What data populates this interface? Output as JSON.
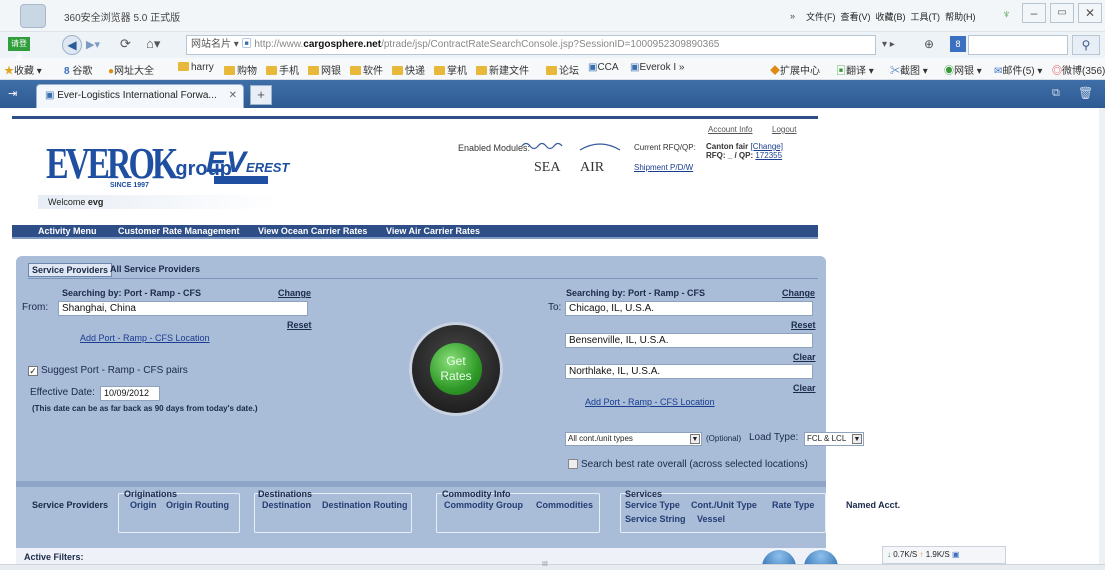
{
  "browser": {
    "title": "360安全浏览器 5.0 正式版",
    "login": "请登录",
    "menu": [
      "文件(F)",
      "查看(V)",
      "收藏(B)",
      "工具(T)",
      "帮助(H)"
    ],
    "url_prefix": "网站名片",
    "url_gray1": "http://www.",
    "url_bold": "cargosphere.net",
    "url_gray2": "/ptrade/jsp/ContractRateSearchConsole.jsp?SessionID=1000952309890365",
    "fav_label": "收藏",
    "favorites": [
      "谷歌",
      "网址大全",
      "harry",
      "购物",
      "手机",
      "网银",
      "软件",
      "快递",
      "掌机",
      "新建文件",
      "论坛",
      "CCA",
      "Everok I"
    ],
    "right_tools": [
      "扩展中心",
      "翻译",
      "截图",
      "网银",
      "邮件(5)",
      "微博(356)"
    ],
    "tab_title": "Ever-Logistics International Forwa...",
    "status": {
      "down": "0.7K/S",
      "up": "1.9K/S"
    },
    "h_scroll_mark": "III"
  },
  "header": {
    "logo_main": "EVEROK",
    "logo_group": "group",
    "logo_since": "SINCE 1997",
    "ev_logo": "EV",
    "ev_rest": "EREST",
    "welcome_label": "Welcome",
    "welcome_user": "evg",
    "account_info": "Account Info",
    "logout": "Logout",
    "enabled_modules": "Enabled Modules:",
    "sea": "SEA",
    "air": "AIR",
    "shipment": "Shipment P/D/W",
    "rfq_label": "Current RFQ/QP:",
    "rfq_value": "Canton fair",
    "change": "[Change]",
    "rfq2": "RFQ: _ / QP:",
    "qp": "172355"
  },
  "nav": [
    "Activity Menu",
    "Customer Rate Management",
    "View Ocean Carrier Rates",
    "View Air Carrier Rates"
  ],
  "search": {
    "tabs": [
      "Service Providers",
      "All Service Providers"
    ],
    "searching_by": "Searching by: Port - Ramp - CFS",
    "change": "Change",
    "from_label": "From:",
    "from_value": "Shanghai, China",
    "reset": "Reset",
    "add_location": "Add Port - Ramp - CFS Location",
    "suggest": "Suggest Port - Ramp - CFS pairs",
    "effective_label": "Effective Date:",
    "effective_value": "10/09/2012",
    "date_note": "(This date can be as far back as 90 days from today's date.)",
    "get_rates": [
      "Get",
      "Rates"
    ],
    "to_label": "To:",
    "to_values": [
      "Chicago, IL, U.S.A.",
      "Bensenville, IL, U.S.A.",
      "Northlake, IL, U.S.A."
    ],
    "clear": "Clear",
    "cont_type": "All cont./unit types",
    "optional": "(Optional)",
    "load_type_label": "Load Type:",
    "load_type_value": "FCL & LCL",
    "best_rate": "Search best rate overall (across selected locations)"
  },
  "filters": {
    "service_providers": "Service Providers",
    "originations": {
      "title": "Originations",
      "items": [
        "Origin",
        "Origin Routing"
      ]
    },
    "destinations": {
      "title": "Destinations",
      "items": [
        "Destination",
        "Destination Routing"
      ]
    },
    "commodity": {
      "title": "Commodity Info",
      "items": [
        "Commodity Group",
        "Commodities"
      ]
    },
    "services": {
      "title": "Services",
      "items": [
        "Service Type",
        "Cont./Unit Type",
        "Rate Type",
        "Service String",
        "Vessel"
      ]
    },
    "named_acct": "Named Acct.",
    "active_filters": "Active Filters:"
  }
}
